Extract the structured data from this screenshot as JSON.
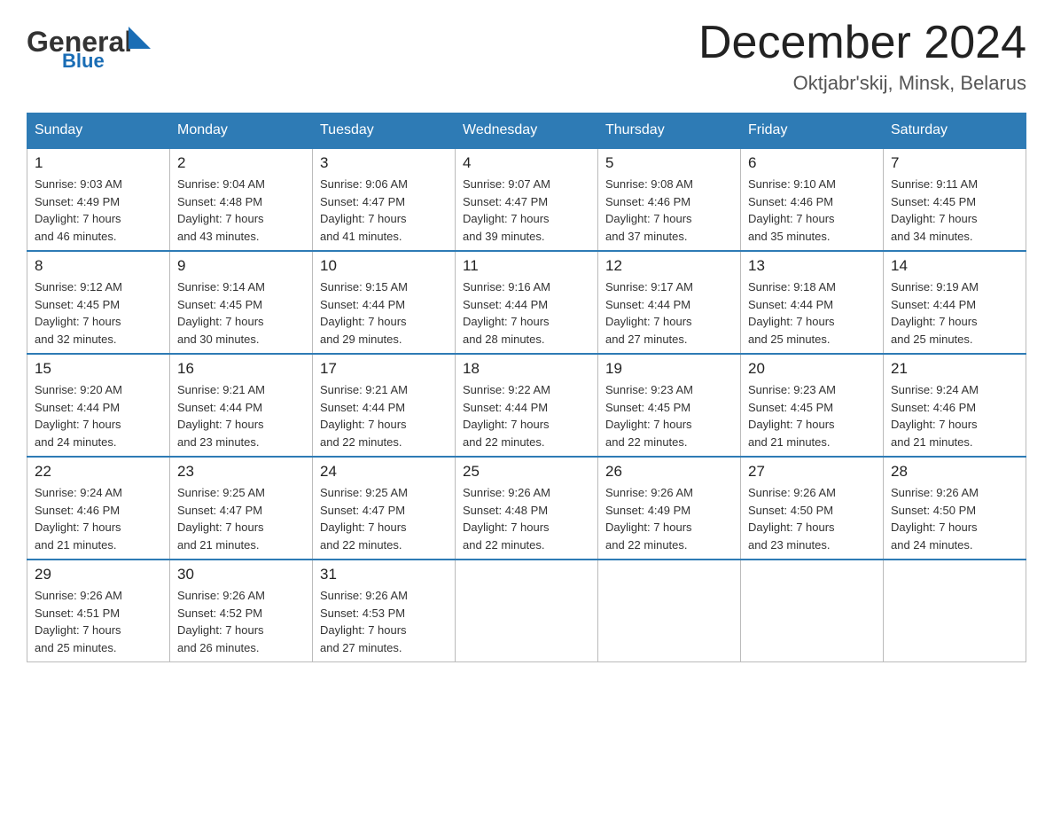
{
  "header": {
    "logo_general": "General",
    "logo_blue": "Blue",
    "title": "December 2024",
    "location": "Oktjabr'skij, Minsk, Belarus"
  },
  "weekdays": [
    "Sunday",
    "Monday",
    "Tuesday",
    "Wednesday",
    "Thursday",
    "Friday",
    "Saturday"
  ],
  "weeks": [
    [
      {
        "day": "1",
        "info": "Sunrise: 9:03 AM\nSunset: 4:49 PM\nDaylight: 7 hours\nand 46 minutes."
      },
      {
        "day": "2",
        "info": "Sunrise: 9:04 AM\nSunset: 4:48 PM\nDaylight: 7 hours\nand 43 minutes."
      },
      {
        "day": "3",
        "info": "Sunrise: 9:06 AM\nSunset: 4:47 PM\nDaylight: 7 hours\nand 41 minutes."
      },
      {
        "day": "4",
        "info": "Sunrise: 9:07 AM\nSunset: 4:47 PM\nDaylight: 7 hours\nand 39 minutes."
      },
      {
        "day": "5",
        "info": "Sunrise: 9:08 AM\nSunset: 4:46 PM\nDaylight: 7 hours\nand 37 minutes."
      },
      {
        "day": "6",
        "info": "Sunrise: 9:10 AM\nSunset: 4:46 PM\nDaylight: 7 hours\nand 35 minutes."
      },
      {
        "day": "7",
        "info": "Sunrise: 9:11 AM\nSunset: 4:45 PM\nDaylight: 7 hours\nand 34 minutes."
      }
    ],
    [
      {
        "day": "8",
        "info": "Sunrise: 9:12 AM\nSunset: 4:45 PM\nDaylight: 7 hours\nand 32 minutes."
      },
      {
        "day": "9",
        "info": "Sunrise: 9:14 AM\nSunset: 4:45 PM\nDaylight: 7 hours\nand 30 minutes."
      },
      {
        "day": "10",
        "info": "Sunrise: 9:15 AM\nSunset: 4:44 PM\nDaylight: 7 hours\nand 29 minutes."
      },
      {
        "day": "11",
        "info": "Sunrise: 9:16 AM\nSunset: 4:44 PM\nDaylight: 7 hours\nand 28 minutes."
      },
      {
        "day": "12",
        "info": "Sunrise: 9:17 AM\nSunset: 4:44 PM\nDaylight: 7 hours\nand 27 minutes."
      },
      {
        "day": "13",
        "info": "Sunrise: 9:18 AM\nSunset: 4:44 PM\nDaylight: 7 hours\nand 25 minutes."
      },
      {
        "day": "14",
        "info": "Sunrise: 9:19 AM\nSunset: 4:44 PM\nDaylight: 7 hours\nand 25 minutes."
      }
    ],
    [
      {
        "day": "15",
        "info": "Sunrise: 9:20 AM\nSunset: 4:44 PM\nDaylight: 7 hours\nand 24 minutes."
      },
      {
        "day": "16",
        "info": "Sunrise: 9:21 AM\nSunset: 4:44 PM\nDaylight: 7 hours\nand 23 minutes."
      },
      {
        "day": "17",
        "info": "Sunrise: 9:21 AM\nSunset: 4:44 PM\nDaylight: 7 hours\nand 22 minutes."
      },
      {
        "day": "18",
        "info": "Sunrise: 9:22 AM\nSunset: 4:44 PM\nDaylight: 7 hours\nand 22 minutes."
      },
      {
        "day": "19",
        "info": "Sunrise: 9:23 AM\nSunset: 4:45 PM\nDaylight: 7 hours\nand 22 minutes."
      },
      {
        "day": "20",
        "info": "Sunrise: 9:23 AM\nSunset: 4:45 PM\nDaylight: 7 hours\nand 21 minutes."
      },
      {
        "day": "21",
        "info": "Sunrise: 9:24 AM\nSunset: 4:46 PM\nDaylight: 7 hours\nand 21 minutes."
      }
    ],
    [
      {
        "day": "22",
        "info": "Sunrise: 9:24 AM\nSunset: 4:46 PM\nDaylight: 7 hours\nand 21 minutes."
      },
      {
        "day": "23",
        "info": "Sunrise: 9:25 AM\nSunset: 4:47 PM\nDaylight: 7 hours\nand 21 minutes."
      },
      {
        "day": "24",
        "info": "Sunrise: 9:25 AM\nSunset: 4:47 PM\nDaylight: 7 hours\nand 22 minutes."
      },
      {
        "day": "25",
        "info": "Sunrise: 9:26 AM\nSunset: 4:48 PM\nDaylight: 7 hours\nand 22 minutes."
      },
      {
        "day": "26",
        "info": "Sunrise: 9:26 AM\nSunset: 4:49 PM\nDaylight: 7 hours\nand 22 minutes."
      },
      {
        "day": "27",
        "info": "Sunrise: 9:26 AM\nSunset: 4:50 PM\nDaylight: 7 hours\nand 23 minutes."
      },
      {
        "day": "28",
        "info": "Sunrise: 9:26 AM\nSunset: 4:50 PM\nDaylight: 7 hours\nand 24 minutes."
      }
    ],
    [
      {
        "day": "29",
        "info": "Sunrise: 9:26 AM\nSunset: 4:51 PM\nDaylight: 7 hours\nand 25 minutes."
      },
      {
        "day": "30",
        "info": "Sunrise: 9:26 AM\nSunset: 4:52 PM\nDaylight: 7 hours\nand 26 minutes."
      },
      {
        "day": "31",
        "info": "Sunrise: 9:26 AM\nSunset: 4:53 PM\nDaylight: 7 hours\nand 27 minutes."
      },
      {
        "day": "",
        "info": ""
      },
      {
        "day": "",
        "info": ""
      },
      {
        "day": "",
        "info": ""
      },
      {
        "day": "",
        "info": ""
      }
    ]
  ]
}
